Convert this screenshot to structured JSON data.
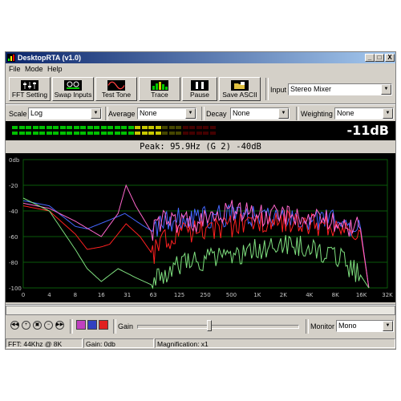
{
  "window": {
    "title": "DesktopRTA (v1.0)",
    "controls": [
      "_",
      "□",
      "X"
    ]
  },
  "menu": [
    "File",
    "Mode",
    "Help"
  ],
  "toolbar": [
    {
      "label": "FFT Setting",
      "icon": "fft-setting-icon"
    },
    {
      "label": "Swap Inputs",
      "icon": "swap-inputs-icon"
    },
    {
      "label": "Test Tone",
      "icon": "sine-wave-icon"
    },
    {
      "label": "Trace",
      "icon": "trace-icon"
    },
    {
      "label": "Pause",
      "icon": "pause-icon"
    },
    {
      "label": "Save ASCII",
      "icon": "save-icon"
    }
  ],
  "input": {
    "label": "Input",
    "value": "Stereo Mixer"
  },
  "options": {
    "scale": {
      "label": "Scale",
      "value": "Log"
    },
    "average": {
      "label": "Average",
      "value": "None"
    },
    "decay": {
      "label": "Decay",
      "value": "None"
    },
    "weighting": {
      "label": "Weighting",
      "value": "None"
    }
  },
  "level_readout": "-11dB",
  "level_meter": {
    "lit_fraction": 0.72,
    "colors": [
      "#00c000",
      "#c8c800",
      "#c00000"
    ]
  },
  "peak_text": "Peak: 95.9Hz (G 2) -40dB",
  "colors": {
    "bg": "#d4d0c8",
    "grid": "#0a5a0a",
    "blue": "#4466ff",
    "red": "#ff2020",
    "pink": "#ff66cc",
    "green": "#7fe07f"
  },
  "chart_data": {
    "type": "line",
    "y_tick_labels": [
      "0db",
      "-20",
      "-40",
      "-60",
      "-80",
      "-100"
    ],
    "x_tick_labels": [
      "0",
      "4",
      "8",
      "16",
      "31",
      "63",
      "125",
      "250",
      "500",
      "1K",
      "2K",
      "4K",
      "8K",
      "16K",
      "32K"
    ],
    "ylim": [
      -100,
      0
    ],
    "series": [
      {
        "color": "#4466ff",
        "points": [
          [
            0,
            -32
          ],
          [
            4,
            -36
          ],
          [
            8,
            -52
          ],
          [
            11,
            -54
          ],
          [
            20,
            -47
          ],
          [
            30,
            -42
          ],
          [
            50,
            -52
          ],
          [
            63,
            -56
          ],
          [
            80,
            -50
          ],
          [
            125,
            -46
          ],
          [
            250,
            -45
          ],
          [
            500,
            -44
          ],
          [
            1000,
            -45
          ],
          [
            2000,
            -44
          ],
          [
            4000,
            -46
          ],
          [
            8000,
            -48
          ],
          [
            16000,
            -53
          ],
          [
            20000,
            -100
          ]
        ]
      },
      {
        "color": "#ff2020",
        "points": [
          [
            0,
            -36
          ],
          [
            4,
            -40
          ],
          [
            8,
            -58
          ],
          [
            11,
            -70
          ],
          [
            16,
            -68
          ],
          [
            20,
            -66
          ],
          [
            31,
            -50
          ],
          [
            45,
            -60
          ],
          [
            63,
            -74
          ],
          [
            80,
            -64
          ],
          [
            125,
            -58
          ],
          [
            250,
            -54
          ],
          [
            500,
            -52
          ],
          [
            1000,
            -50
          ],
          [
            2000,
            -48
          ],
          [
            4000,
            -50
          ],
          [
            8000,
            -52
          ],
          [
            16000,
            -56
          ],
          [
            20000,
            -100
          ]
        ]
      },
      {
        "color": "#ff66cc",
        "points": [
          [
            0,
            -34
          ],
          [
            4,
            -38
          ],
          [
            8,
            -48
          ],
          [
            16,
            -60
          ],
          [
            25,
            -42
          ],
          [
            31,
            -20
          ],
          [
            40,
            -36
          ],
          [
            63,
            -58
          ],
          [
            80,
            -46
          ],
          [
            125,
            -50
          ],
          [
            250,
            -48
          ],
          [
            500,
            -40
          ],
          [
            1000,
            -44
          ],
          [
            2000,
            -42
          ],
          [
            4000,
            -46
          ],
          [
            8000,
            -48
          ],
          [
            16000,
            -54
          ],
          [
            20000,
            -100
          ]
        ]
      },
      {
        "color": "#7fe07f",
        "points": [
          [
            0,
            -30
          ],
          [
            4,
            -40
          ],
          [
            8,
            -70
          ],
          [
            11,
            -85
          ],
          [
            16,
            -95
          ],
          [
            25,
            -85
          ],
          [
            40,
            -92
          ],
          [
            63,
            -98
          ],
          [
            80,
            -90
          ],
          [
            125,
            -82
          ],
          [
            250,
            -78
          ],
          [
            500,
            -76
          ],
          [
            1000,
            -70
          ],
          [
            2000,
            -66
          ],
          [
            4000,
            -68
          ],
          [
            8000,
            -74
          ],
          [
            16000,
            -90
          ],
          [
            20000,
            -100
          ]
        ]
      }
    ]
  },
  "gain": {
    "label": "Gain",
    "fraction": 0.45
  },
  "monitor": {
    "label": "Monitor",
    "value": "Mono"
  },
  "status": {
    "fft": "FFT: 44Khz @ 8K",
    "gain": "Gain: 0db",
    "magnification": "Magnification: x1"
  }
}
